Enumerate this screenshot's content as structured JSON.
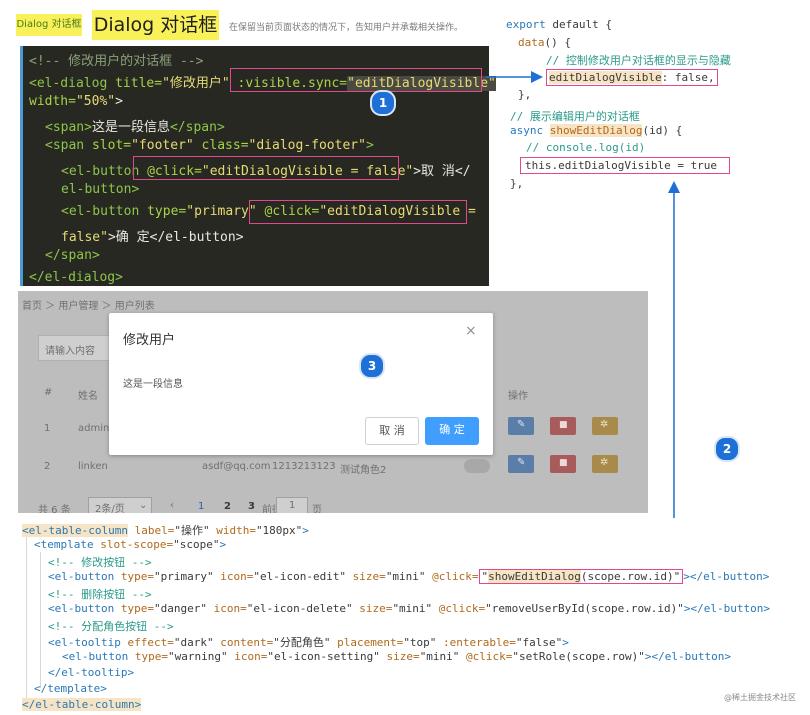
{
  "header": {
    "badge_small": "Dialog 对话框",
    "badge_big": "Dialog 对话框",
    "subtitle": "在保留当前页面状态的情况下，告知用户并承载相关操作。"
  },
  "dark_code": {
    "line1": "<!-- 修改用户的对话框 -->",
    "line2_a": "<el-dialog",
    "line2_b": " title=",
    "line2_c": "\"修改用户\"",
    "line2_d": " :visible.sync=",
    "line2_e": "\"editDialogVisible\"",
    "line3_a": "width=",
    "line3_b": "\"50%\"",
    "line3_c": ">",
    "line4_a": "<span>",
    "line4_b": "这是一段信息",
    "line4_c": "</span>",
    "line5_a": "<span",
    "line5_b": " slot=",
    "line5_c": "\"footer\"",
    "line5_d": " class=",
    "line5_e": "\"dialog-footer\"",
    "line5_f": ">",
    "line6_a": "<el-button",
    "line6_b": " @click=",
    "line6_c": "\"editDialogVisible = false\"",
    "line6_d": ">取 消</",
    "line7": "el-button>",
    "line8_a": "<el-button",
    "line8_b": " type=",
    "line8_c": "\"primary\"",
    "line8_d": " @click=",
    "line8_e": "\"editDialogVisible =",
    "line9_a": "false\"",
    "line9_b": ">确 定</el-button>",
    "line10": "</span>",
    "line11": "</el-dialog>"
  },
  "right_code": {
    "l1_a": "export",
    "l1_b": " default {",
    "l2_a": "data",
    "l2_b": "() {",
    "l3": "// 控制修改用户对话框的显示与隐藏",
    "l4_a": "editDialogVisible",
    "l4_b": ": false,",
    "l5": "},",
    "l6": "// 展示编辑用户的对话框",
    "l7_a": "async",
    "l7_b": "showEditDialog",
    "l7_c": "(id) {",
    "l8": "// console.log(id)",
    "l9": "this.editDialogVisible = true",
    "l10": "},"
  },
  "app": {
    "breadcrumb": [
      "首页",
      "用户管理",
      "用户列表"
    ],
    "search_placeholder": "请输入内容",
    "table_headers": [
      "#",
      "姓名",
      "操作"
    ],
    "row1": {
      "index": "1",
      "name": "admin"
    },
    "row2": {
      "index": "2",
      "name": "linken",
      "email": "asdf@qq.com",
      "phone": "1213213123",
      "role": "测试角色2"
    },
    "pager": {
      "total": "共 6 条",
      "size": "2条/页",
      "pages": [
        "1",
        "2",
        "3"
      ],
      "goto_prefix": "前往",
      "goto_value": "1",
      "goto_suffix": "页"
    },
    "modal": {
      "title": "修改用户",
      "body": "这是一段信息",
      "cancel": "取 消",
      "confirm": "确 定",
      "close": "×"
    }
  },
  "circles": {
    "c1": "1",
    "c2": "2",
    "c3": "3"
  },
  "bottom_code": {
    "l1_a": "<el-table-column",
    "l1_b": " label=",
    "l1_c": "\"操作\"",
    "l1_d": " width=",
    "l1_e": "\"180px\"",
    "l1_f": ">",
    "l2_a": "<template",
    "l2_b": " slot-scope=",
    "l2_c": "\"scope\"",
    "l2_d": ">",
    "l3": "<!-- 修改按钮 -->",
    "l4_a": "<el-button",
    "l4_b": " type=",
    "l4_c": "\"primary\"",
    "l4_d": " icon=",
    "l4_e": "\"el-icon-edit\"",
    "l4_f": " size=",
    "l4_g": "\"mini\"",
    "l4_h": " @click=",
    "l4_i": "\"",
    "l4_j": "showEditDialog",
    "l4_k": "(scope.row.id)\"",
    "l4_l": "></el-button>",
    "l5": "<!-- 删除按钮 -->",
    "l6_a": "<el-button",
    "l6_b": " type=",
    "l6_c": "\"danger\"",
    "l6_d": " icon=",
    "l6_e": "\"el-icon-delete\"",
    "l6_f": " size=",
    "l6_g": "\"mini\"",
    "l6_h": " @click=",
    "l6_i": "\"removeUserById(scope.row.id)\"",
    "l6_j": "></el-button>",
    "l7": "<!-- 分配角色按钮 -->",
    "l8_a": "<el-tooltip",
    "l8_b": " effect=",
    "l8_c": "\"dark\"",
    "l8_d": " content=",
    "l8_e": "\"分配角色\"",
    "l8_f": " placement=",
    "l8_g": "\"top\"",
    "l8_h": " :enterable=",
    "l8_i": "\"false\"",
    "l8_j": ">",
    "l9_a": "<el-button",
    "l9_b": " type=",
    "l9_c": "\"warning\"",
    "l9_d": " icon=",
    "l9_e": "\"el-icon-setting\"",
    "l9_f": " size=",
    "l9_g": "\"mini\"",
    "l9_h": " @click=",
    "l9_i": "\"setRole(scope.row)\"",
    "l9_j": "></el-button>",
    "l10": "</el-tooltip>",
    "l11": "</template>",
    "l12": "</el-table-column>"
  },
  "watermark": "@稀土掘金技术社区",
  "colors": {
    "highlight_box": "#e04a8d",
    "arrow": "#1e6fd6",
    "primary_btn": "#409eff",
    "danger_btn": "#f56c6c",
    "warning_btn": "#e6a23c"
  }
}
